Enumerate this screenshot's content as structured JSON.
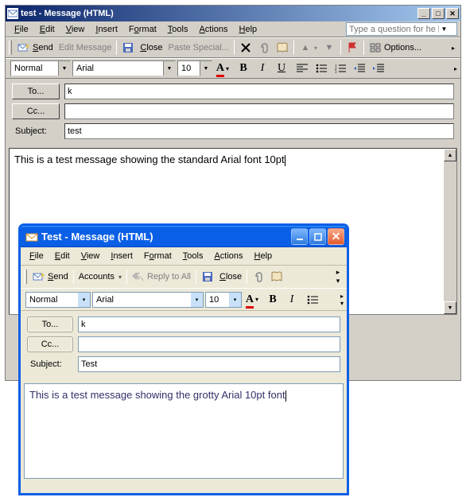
{
  "win1": {
    "title": "test - Message (HTML)",
    "menu": {
      "file": "File",
      "edit": "Edit",
      "view": "View",
      "insert": "Insert",
      "format": "Format",
      "tools": "Tools",
      "actions": "Actions",
      "help": "Help"
    },
    "helpbox_placeholder": "Type a question for help",
    "tb": {
      "send": "Send",
      "editmsg": "Edit Message",
      "close": "Close",
      "pastespecial": "Paste Special...",
      "options": "Options..."
    },
    "fmt": {
      "style": "Normal",
      "font": "Arial",
      "size": "10"
    },
    "fields": {
      "to_label": "To...",
      "to": "k",
      "cc_label": "Cc...",
      "cc": "",
      "subject_label": "Subject:",
      "subject": "test"
    },
    "body": "This is a test message showing the standard Arial font 10pt"
  },
  "win2": {
    "title": "Test - Message (HTML)",
    "menu": {
      "file": "File",
      "edit": "Edit",
      "view": "View",
      "insert": "Insert",
      "format": "Format",
      "tools": "Tools",
      "actions": "Actions",
      "help": "Help"
    },
    "tb": {
      "send": "Send",
      "accounts": "Accounts",
      "replyall": "Reply to All",
      "close": "Close"
    },
    "fmt": {
      "style": "Normal",
      "font": "Arial",
      "size": "10"
    },
    "fields": {
      "to_label": "To...",
      "to": "k",
      "cc_label": "Cc...",
      "cc": "",
      "subject_label": "Subject:",
      "subject": "Test"
    },
    "body": "This is a test message showing the grotty Arial 10pt font"
  }
}
